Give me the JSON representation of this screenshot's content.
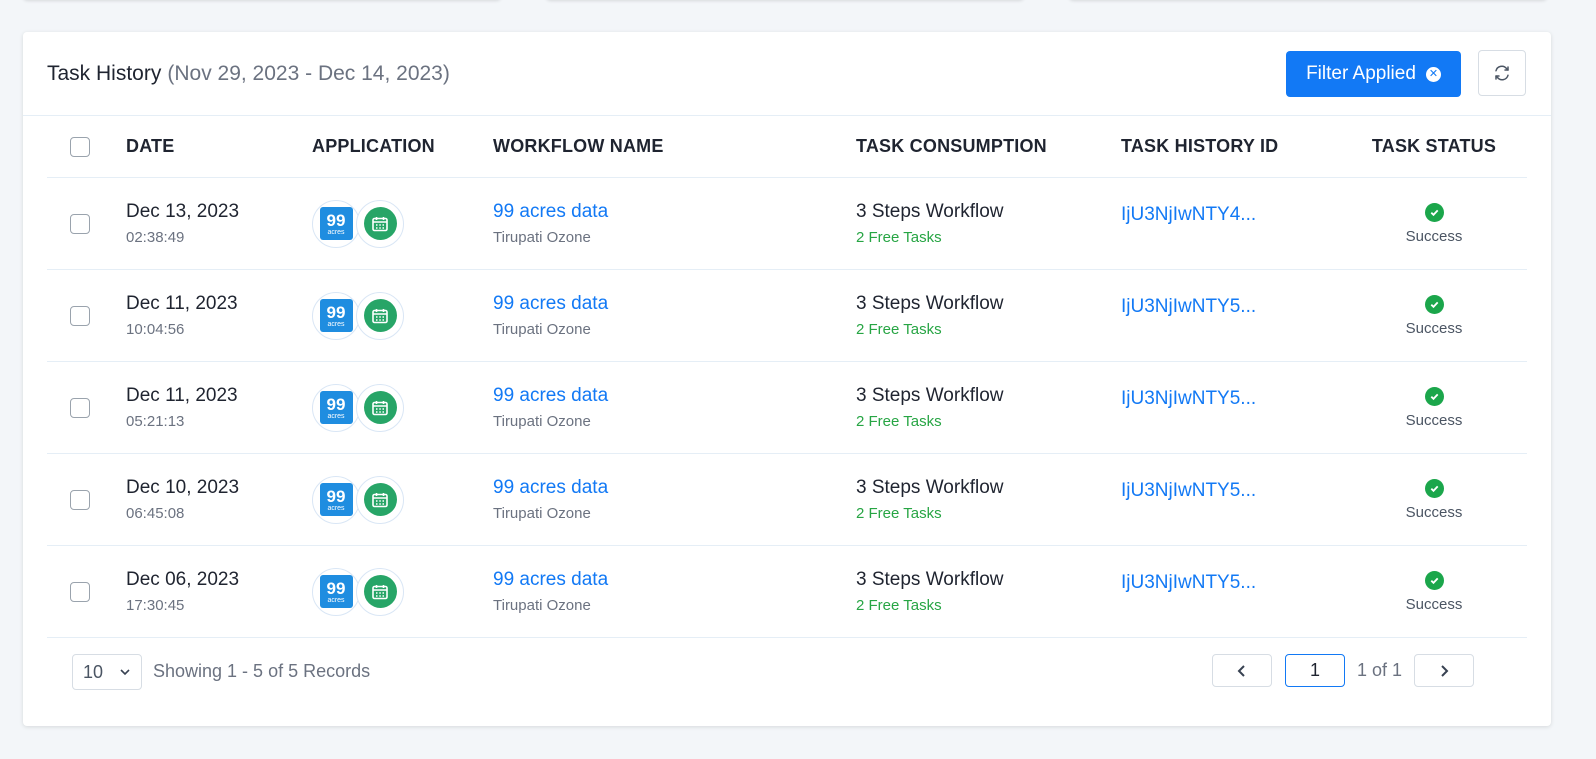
{
  "header": {
    "title": "Task History",
    "date_range": "(Nov 29, 2023 - Dec 14, 2023)",
    "filter_label": "Filter Applied",
    "colors": {
      "primary": "#1279f5",
      "success": "#1ba64b"
    }
  },
  "columns": {
    "date": "DATE",
    "application": "APPLICATION",
    "workflow": "WORKFLOW NAME",
    "consumption": "TASK CONSUMPTION",
    "history_id": "TASK HISTORY ID",
    "status": "TASK STATUS"
  },
  "rows": [
    {
      "date": "Dec 13, 2023",
      "time": "02:38:49",
      "app1": "99",
      "app1_sub": "acres",
      "workflow": "99 acres data",
      "sub": "Tirupati Ozone",
      "consumption": "3 Steps Workflow",
      "free": "2 Free Tasks",
      "id": "IjU3NjIwNTY4...",
      "status": "Success"
    },
    {
      "date": "Dec 11, 2023",
      "time": "10:04:56",
      "app1": "99",
      "app1_sub": "acres",
      "workflow": "99 acres data",
      "sub": "Tirupati Ozone",
      "consumption": "3 Steps Workflow",
      "free": "2 Free Tasks",
      "id": "IjU3NjIwNTY5...",
      "status": "Success"
    },
    {
      "date": "Dec 11, 2023",
      "time": "05:21:13",
      "app1": "99",
      "app1_sub": "acres",
      "workflow": "99 acres data",
      "sub": "Tirupati Ozone",
      "consumption": "3 Steps Workflow",
      "free": "2 Free Tasks",
      "id": "IjU3NjIwNTY5...",
      "status": "Success"
    },
    {
      "date": "Dec 10, 2023",
      "time": "06:45:08",
      "app1": "99",
      "app1_sub": "acres",
      "workflow": "99 acres data",
      "sub": "Tirupati Ozone",
      "consumption": "3 Steps Workflow",
      "free": "2 Free Tasks",
      "id": "IjU3NjIwNTY5...",
      "status": "Success"
    },
    {
      "date": "Dec 06, 2023",
      "time": "17:30:45",
      "app1": "99",
      "app1_sub": "acres",
      "workflow": "99 acres data",
      "sub": "Tirupati Ozone",
      "consumption": "3 Steps Workflow",
      "free": "2 Free Tasks",
      "id": "IjU3NjIwNTY5...",
      "status": "Success"
    }
  ],
  "footer": {
    "page_size": "10",
    "showing": "Showing 1 - 5 of 5 Records",
    "current_page": "1",
    "page_of": "1 of 1"
  }
}
